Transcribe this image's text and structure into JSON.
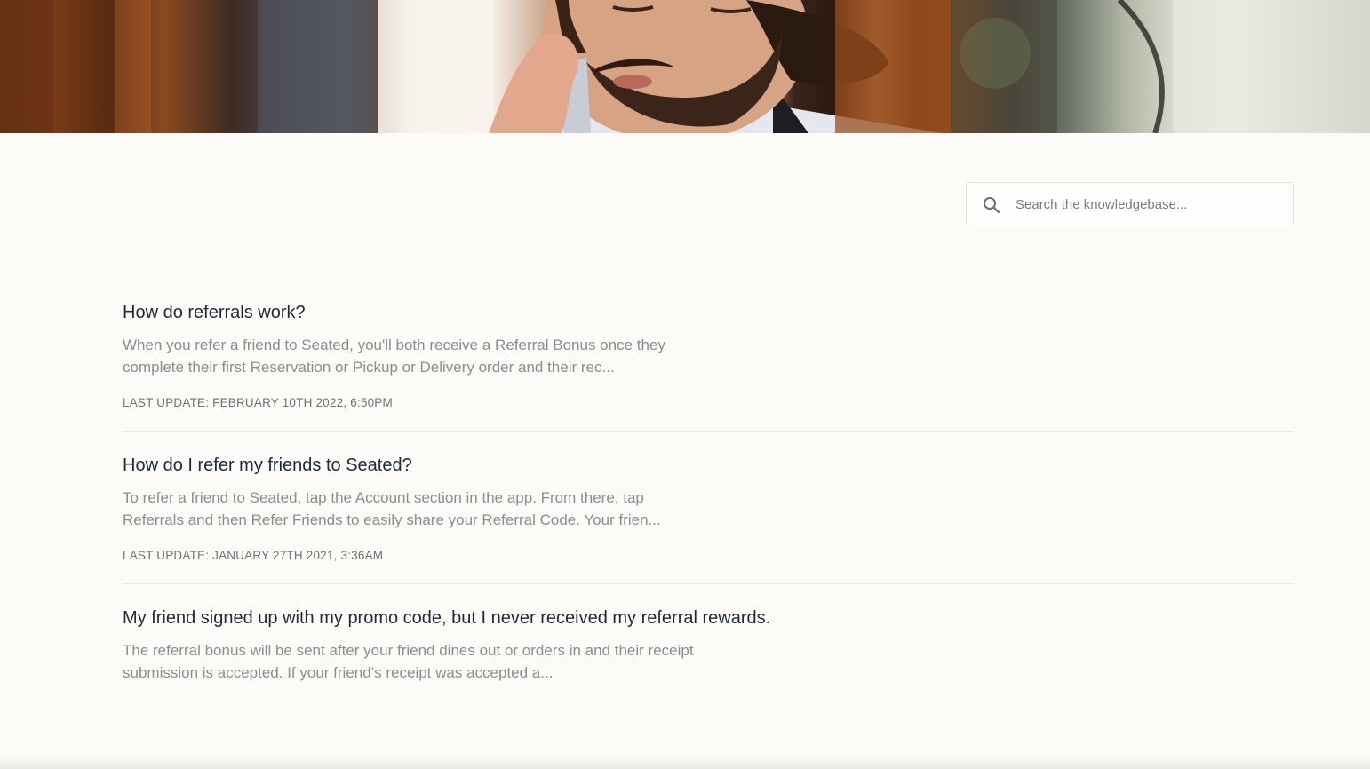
{
  "hero": {
    "image": "man-on-phone-photo"
  },
  "search": {
    "placeholder": "Search the knowledgebase...",
    "value": "",
    "icon": "search-icon"
  },
  "articles": [
    {
      "title": "How do referrals work?",
      "excerpt": "When you refer a friend to Seated, you'll both receive a Referral Bonus once they complete their first Reservation or Pickup or Delivery order and their rec...",
      "last_update": "LAST UPDATE: FEBRUARY 10TH 2022, 6:50PM"
    },
    {
      "title": "How do I refer my friends to Seated?",
      "excerpt": "To refer a friend to Seated, tap the Account section in the app. From there, tap Referrals and then Refer Friends to easily share your Referral Code. Your frien...",
      "last_update": "LAST UPDATE: JANUARY 27TH 2021, 3:36AM"
    },
    {
      "title": "My friend signed up with my promo code, but I never received my referral rewards.",
      "excerpt": "The referral bonus will be sent after your friend dines out or orders in and their receipt submission is accepted. If your friend’s receipt was accepted a...",
      "last_update": ""
    }
  ],
  "colors": {
    "background": "#fcfbf8",
    "title": "#1d2a3b",
    "excerpt": "#8b8d91",
    "meta": "#6f7276",
    "border": "#e3e1dc"
  }
}
